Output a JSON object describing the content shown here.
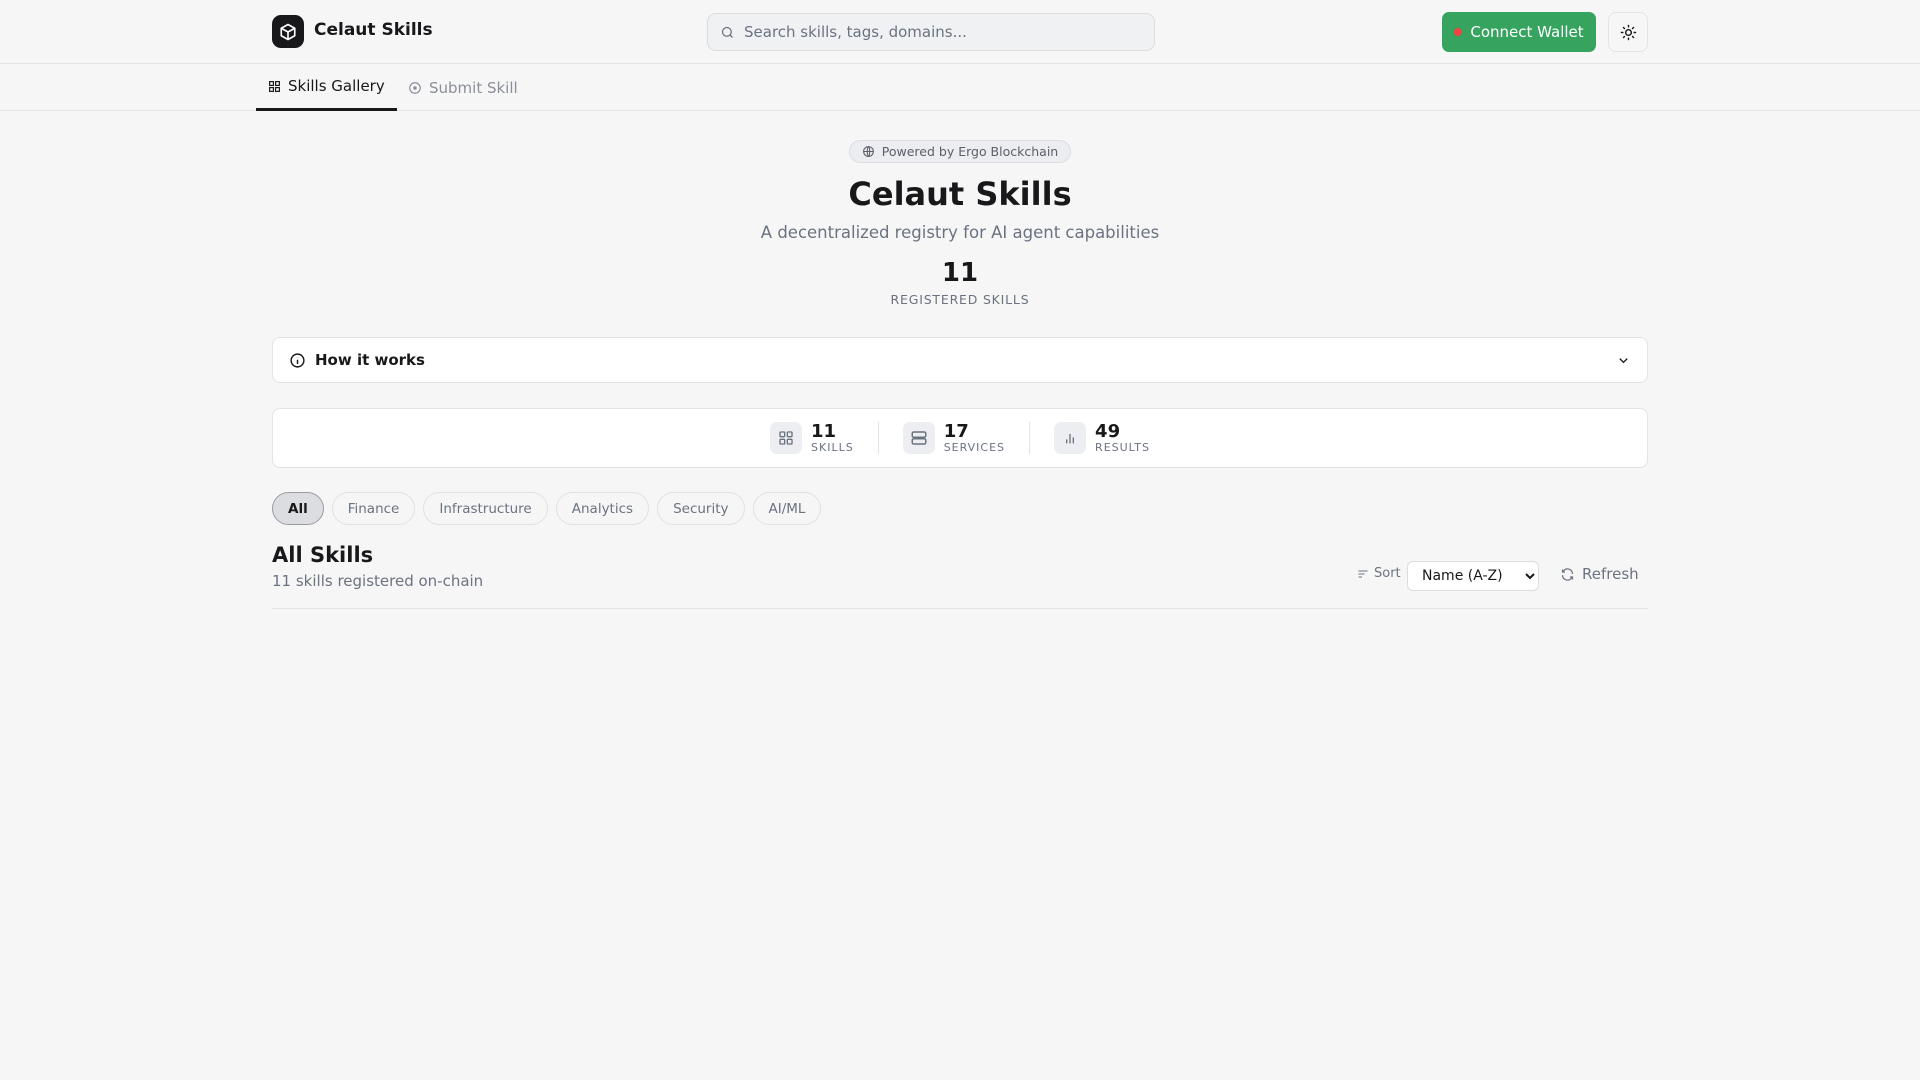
{
  "header": {
    "brand": "Celaut Skills",
    "search_placeholder": "Search skills, tags, domains...",
    "connect_wallet": "Connect Wallet",
    "wallet_status_color": "#ef4444",
    "accent": "#36a35f"
  },
  "nav": {
    "tabs": [
      {
        "label": "Skills Gallery",
        "active": true
      },
      {
        "label": "Submit Skill",
        "active": false
      }
    ]
  },
  "hero": {
    "badge": "Powered by Ergo Blockchain",
    "title": "Celaut Skills",
    "subtitle": "A decentralized registry for AI agent capabilities",
    "count": "11",
    "count_label": "REGISTERED SKILLS"
  },
  "how_it_works": {
    "label": "How it works"
  },
  "stats": [
    {
      "value": "11",
      "label": "SKILLS"
    },
    {
      "value": "17",
      "label": "SERVICES"
    },
    {
      "value": "49",
      "label": "RESULTS"
    }
  ],
  "filters": [
    "All",
    "Finance",
    "Infrastructure",
    "Analytics",
    "Security",
    "AI/ML"
  ],
  "list": {
    "title": "All Skills",
    "subtitle": "11 skills registered on-chain",
    "sort_label": "Sort",
    "sort_value": "Name (A-Z)",
    "refresh": "Refresh"
  }
}
